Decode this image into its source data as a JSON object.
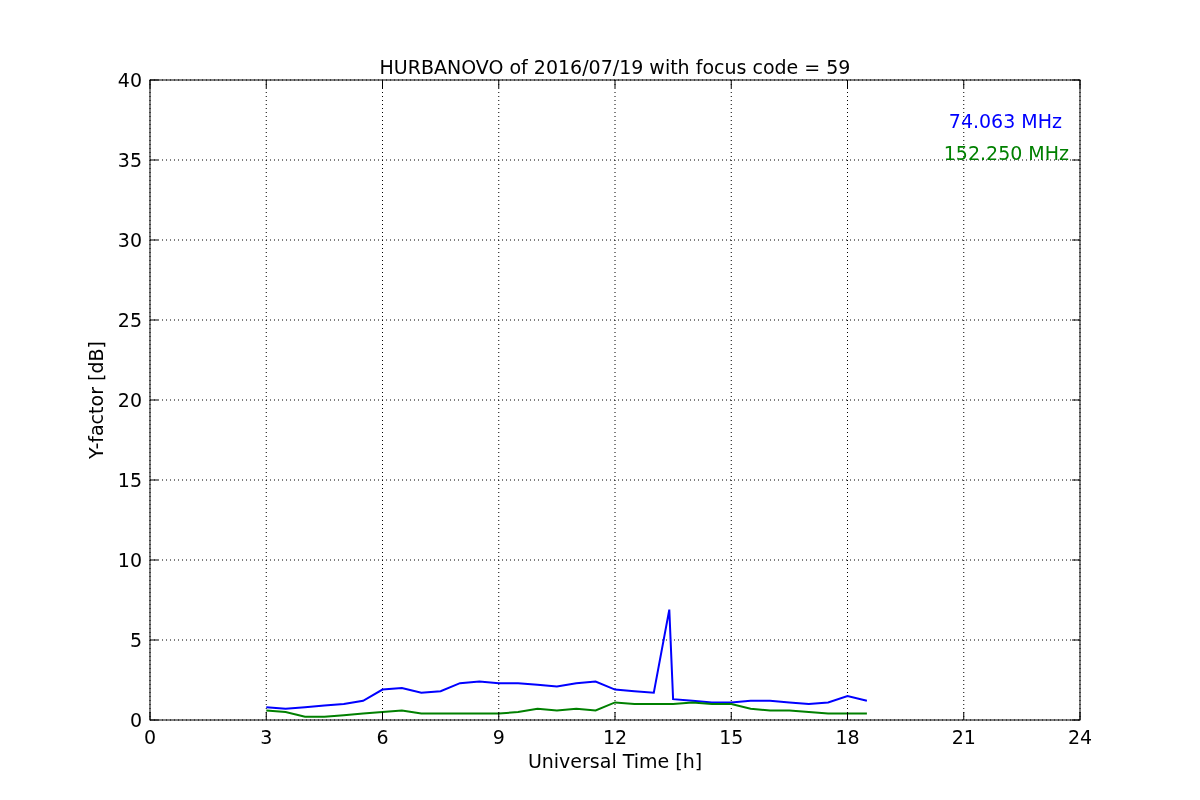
{
  "chart_data": {
    "type": "line",
    "title": "HURBANOVO of 2016/07/19 with focus code = 59",
    "xlabel": "Universal Time [h]",
    "ylabel": "Y-factor [dB]",
    "x": [
      3,
      3.5,
      4,
      4.5,
      5,
      5.5,
      6,
      6.5,
      7,
      7.5,
      8,
      8.5,
      9,
      9.5,
      10,
      10.5,
      11,
      11.5,
      12,
      12.5,
      13,
      13.4,
      13.5,
      14,
      14.5,
      15,
      15.5,
      16,
      16.5,
      17,
      17.5,
      18,
      18.5
    ],
    "series": [
      {
        "name": "74.063 MHz",
        "color": "#0000ff",
        "values": [
          0.8,
          0.7,
          0.8,
          0.9,
          1.0,
          1.2,
          1.9,
          2.0,
          1.7,
          1.8,
          2.3,
          2.4,
          2.3,
          2.3,
          2.2,
          2.1,
          2.3,
          2.4,
          1.9,
          1.8,
          1.7,
          6.9,
          1.3,
          1.2,
          1.1,
          1.1,
          1.2,
          1.2,
          1.1,
          1.0,
          1.1,
          1.5,
          1.2
        ]
      },
      {
        "name": "152.250 MHz",
        "color": "#008000",
        "values": [
          0.6,
          0.5,
          0.2,
          0.2,
          0.3,
          0.4,
          0.5,
          0.6,
          0.4,
          0.4,
          0.4,
          0.4,
          0.4,
          0.5,
          0.7,
          0.6,
          0.7,
          0.6,
          1.1,
          1.0,
          1.0,
          1.0,
          1.0,
          1.1,
          1.0,
          1.0,
          0.7,
          0.6,
          0.6,
          0.5,
          0.4,
          0.4,
          0.4
        ]
      }
    ],
    "xlim": [
      0,
      24
    ],
    "ylim": [
      0,
      40
    ],
    "xticks": [
      0,
      3,
      6,
      9,
      12,
      15,
      18,
      21,
      24
    ],
    "yticks": [
      0,
      5,
      10,
      15,
      20,
      25,
      30,
      35,
      40
    ],
    "grid": true
  }
}
